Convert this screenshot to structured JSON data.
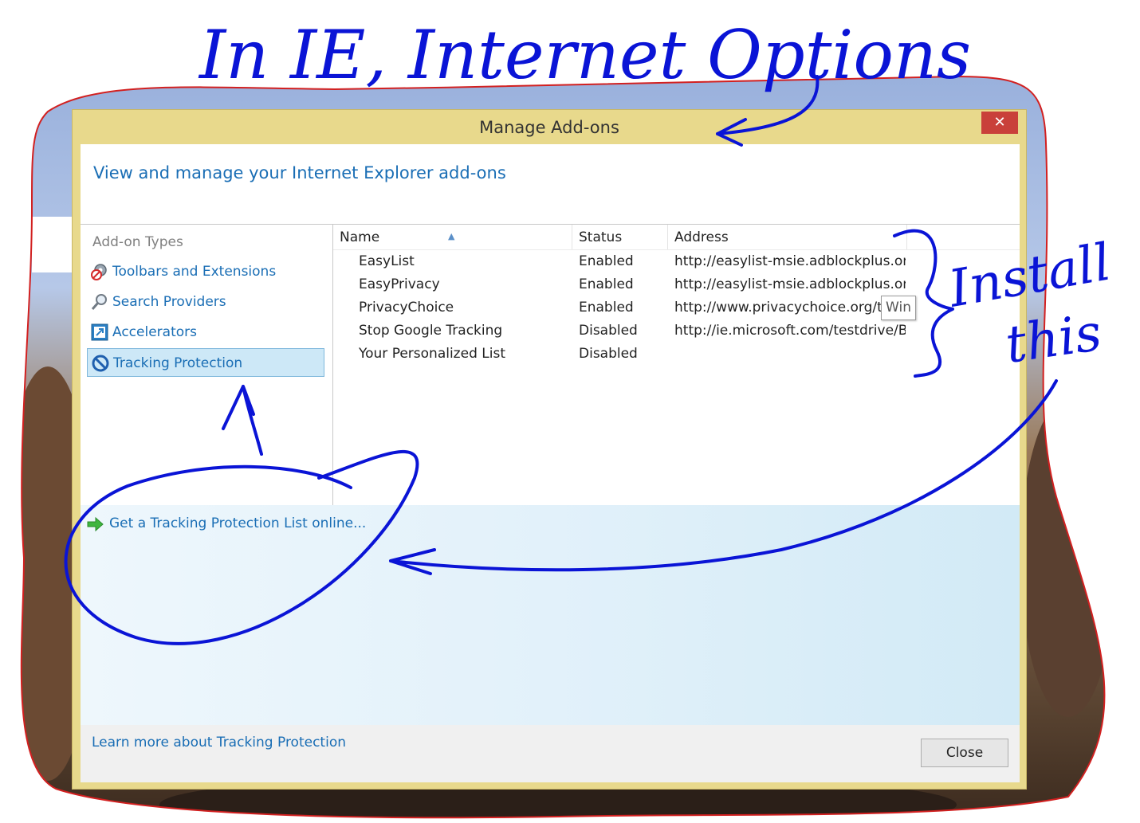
{
  "annotations": {
    "top_note": "In IE, Internet Options",
    "install_note_line1": "Install",
    "install_note_line2": "this"
  },
  "dialog": {
    "title": "Manage Add-ons",
    "close_glyph": "✕",
    "header_title": "View and manage your Internet Explorer add-ons"
  },
  "sidebar": {
    "section_label": "Add-on Types",
    "items": [
      {
        "label": "Toolbars and Extensions",
        "icon": "gear-blocked-icon",
        "selected": false
      },
      {
        "label": "Search Providers",
        "icon": "magnifier-icon",
        "selected": false
      },
      {
        "label": "Accelerators",
        "icon": "accelerator-icon",
        "selected": false
      },
      {
        "label": "Tracking Protection",
        "icon": "no-entry-icon",
        "selected": true
      }
    ]
  },
  "list": {
    "columns": [
      "Name",
      "Status",
      "Address"
    ],
    "sort_indicator": "▲",
    "rows": [
      {
        "name": "EasyList",
        "status": "Enabled",
        "address": "http://easylist-msie.adblockplus.or..."
      },
      {
        "name": "EasyPrivacy",
        "status": "Enabled",
        "address": "http://easylist-msie.adblockplus.or..."
      },
      {
        "name": "PrivacyChoice",
        "status": "Enabled",
        "address": "http://www.privacychoice.org/tra"
      },
      {
        "name": "Stop Google Tracking",
        "status": "Disabled",
        "address": "http://ie.microsoft.com/testdrive/B..."
      },
      {
        "name": "Your Personalized List",
        "status": "Disabled",
        "address": ""
      }
    ],
    "tooltip": "Win"
  },
  "info": {
    "get_list_link": "Get a Tracking Protection List online..."
  },
  "footer": {
    "learn_more_link": "Learn more about Tracking Protection",
    "close_button": "Close"
  },
  "colors": {
    "ink": "#0a14d6",
    "outline": "#d22020",
    "link": "#1a6eb5",
    "selection": "#cde8f7",
    "titlebar": "#e8d98c",
    "close_red": "#c9403a"
  }
}
